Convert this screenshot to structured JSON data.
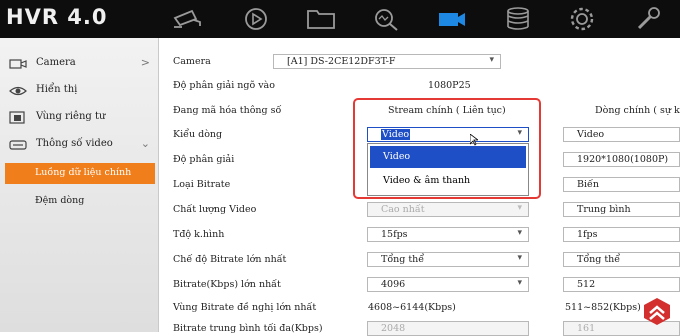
{
  "app": {
    "title": "HVR 4.0",
    "nav_icons": [
      "camera-icon",
      "playback-icon",
      "folder-icon",
      "search-icon",
      "record-icon",
      "storage-icon",
      "settings-icon",
      "maintenance-icon"
    ]
  },
  "sidebar": {
    "items": [
      {
        "label": "Camera",
        "arrow": ">"
      },
      {
        "label": "Hiển thị",
        "arrow": ""
      },
      {
        "label": "Vùng riêng tư",
        "arrow": ""
      },
      {
        "label": "Thông số video",
        "arrow": "⌄"
      }
    ],
    "subitems": [
      {
        "label": "Luồng dữ liệu chính",
        "active": true
      },
      {
        "label": "Đệm dòng",
        "active": false
      }
    ]
  },
  "form": {
    "camera_label": "Camera",
    "camera_value": "[A1] DS-2CE12DF3T-F",
    "input_res_label": "Độ phân giải ngõ vào",
    "input_res_value": "1080P25",
    "encode_label": "Đang mã hóa thông số",
    "col1_header": "Stream chính ( Liên tục)",
    "col2_header": "Dòng chính ( sự ki",
    "rows": [
      {
        "label": "Kiểu dòng",
        "v1": "Video",
        "v2": "Video"
      },
      {
        "label": "Độ phân giải",
        "v1": "",
        "v2": "1920*1080(1080P)"
      },
      {
        "label": "Loại Bitrate",
        "v1": "",
        "v2": "Biến"
      },
      {
        "label": "Chất lượng Video",
        "v1": "Cao nhất",
        "v2": "Trung bình"
      },
      {
        "label": "Tđộ k.hình",
        "v1": "15fps",
        "v2": "1fps"
      },
      {
        "label": "Chế độ Bitrate lớn nhất",
        "v1": "Tổng thể",
        "v2": "Tổng thể"
      },
      {
        "label": "Bitrate(Kbps) lớn nhất",
        "v1": "4096",
        "v2": "512"
      },
      {
        "label": "Vùng Bitrate đề nghị lớn nhất",
        "v1": "4608~6144(Kbps)",
        "v2": "511~852(Kbps)"
      },
      {
        "label": "Bitrate trung bình tối đa(Kbps)",
        "v1": "2048",
        "v2": "161"
      }
    ],
    "dropdown_options": [
      "Video",
      "Video & âm thanh"
    ],
    "dropdown_selected": "Video"
  },
  "colors": {
    "accent": "#f07e1b",
    "highlight": "#1f4fc7",
    "annotation": "#e53935",
    "topbar": "#0d0d0d",
    "nav_active": "#1e88e5"
  }
}
